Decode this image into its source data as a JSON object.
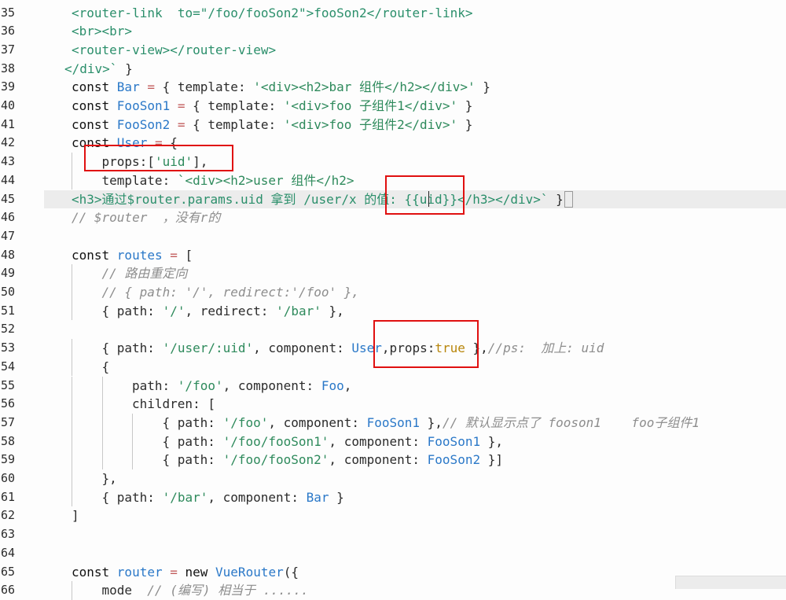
{
  "editor": {
    "lines": [
      {
        "num": "35",
        "indent": 1,
        "tokens": [
          {
            "t": "tag",
            "v": "<router-link  "
          },
          {
            "t": "tag",
            "v": "to=\"/foo/fooSon2\">fooSon2</router-link>"
          }
        ]
      },
      {
        "num": "36",
        "indent": 1,
        "tokens": [
          {
            "t": "tag",
            "v": "<br><br>"
          }
        ]
      },
      {
        "num": "37",
        "indent": 1,
        "tokens": [
          {
            "t": "tag",
            "v": "<router-view></router-view>"
          }
        ]
      },
      {
        "num": "38",
        "indent": 0,
        "lead": "  ",
        "tokens": [
          {
            "t": "tag",
            "v": "</div>`"
          },
          {
            "t": "plain",
            "v": " }"
          }
        ]
      },
      {
        "num": "39",
        "indent": 1,
        "tokens": [
          {
            "t": "kw",
            "v": "const "
          },
          {
            "t": "def",
            "v": "Bar"
          },
          {
            "t": "op",
            "v": " = "
          },
          {
            "t": "plain",
            "v": "{ template: "
          },
          {
            "t": "str",
            "v": "'<div><h2>bar 组件</h2></div>'"
          },
          {
            "t": "plain",
            "v": " }"
          }
        ]
      },
      {
        "num": "40",
        "indent": 1,
        "tokens": [
          {
            "t": "kw",
            "v": "const "
          },
          {
            "t": "def",
            "v": "FooSon1"
          },
          {
            "t": "op",
            "v": " = "
          },
          {
            "t": "plain",
            "v": "{ template: "
          },
          {
            "t": "str",
            "v": "'<div>foo 子组件1</div>'"
          },
          {
            "t": "plain",
            "v": " }"
          }
        ]
      },
      {
        "num": "41",
        "indent": 1,
        "tokens": [
          {
            "t": "kw",
            "v": "const "
          },
          {
            "t": "def",
            "v": "FooSon2"
          },
          {
            "t": "op",
            "v": " = "
          },
          {
            "t": "plain",
            "v": "{ template: "
          },
          {
            "t": "str",
            "v": "'<div>foo 子组件2</div>'"
          },
          {
            "t": "plain",
            "v": " }"
          }
        ]
      },
      {
        "num": "42",
        "indent": 1,
        "tokens": [
          {
            "t": "kw",
            "v": "const "
          },
          {
            "t": "def",
            "v": "User"
          },
          {
            "t": "op",
            "v": " = "
          },
          {
            "t": "plain",
            "v": "{"
          }
        ]
      },
      {
        "num": "43",
        "indent": 2,
        "tokens": [
          {
            "t": "plain",
            "v": "props:["
          },
          {
            "t": "str",
            "v": "'uid'"
          },
          {
            "t": "plain",
            "v": "],"
          }
        ]
      },
      {
        "num": "44",
        "indent": 2,
        "tokens": [
          {
            "t": "plain",
            "v": "template: "
          },
          {
            "t": "str",
            "v": "`<div><h2>user 组件</h2>"
          }
        ]
      },
      {
        "num": "45",
        "indent": 1,
        "current": true,
        "tokens": [
          {
            "t": "tag",
            "v": "<h3>通过$router.params.uid 拿到 /user/x 的值: {{uid}}</h3></div>`"
          },
          {
            "t": "plain",
            "v": " }"
          }
        ]
      },
      {
        "num": "46",
        "indent": 1,
        "tokens": [
          {
            "t": "cmt",
            "v": "// $router  ，没有r的"
          }
        ]
      },
      {
        "num": "47",
        "indent": 0,
        "tokens": []
      },
      {
        "num": "48",
        "indent": 1,
        "tokens": [
          {
            "t": "kw",
            "v": "const "
          },
          {
            "t": "def",
            "v": "routes"
          },
          {
            "t": "op",
            "v": " = "
          },
          {
            "t": "plain",
            "v": "["
          }
        ]
      },
      {
        "num": "49",
        "indent": 2,
        "tokens": [
          {
            "t": "cmt",
            "v": "// 路由重定向"
          }
        ]
      },
      {
        "num": "50",
        "indent": 2,
        "tokens": [
          {
            "t": "cmt",
            "v": "// { path: '/', redirect:'/foo' },"
          }
        ]
      },
      {
        "num": "51",
        "indent": 2,
        "tokens": [
          {
            "t": "plain",
            "v": "{ path: "
          },
          {
            "t": "str",
            "v": "'/'"
          },
          {
            "t": "plain",
            "v": ", redirect: "
          },
          {
            "t": "str",
            "v": "'/bar'"
          },
          {
            "t": "plain",
            "v": " },"
          }
        ]
      },
      {
        "num": "52",
        "indent": 0,
        "tokens": []
      },
      {
        "num": "53",
        "indent": 2,
        "tokens": [
          {
            "t": "plain",
            "v": "{ path: "
          },
          {
            "t": "str",
            "v": "'/user/:uid'"
          },
          {
            "t": "plain",
            "v": ", component: "
          },
          {
            "t": "def",
            "v": "User"
          },
          {
            "t": "plain",
            "v": ",props:"
          },
          {
            "t": "bool",
            "v": "true"
          },
          {
            "t": "plain",
            "v": " },"
          },
          {
            "t": "cmt",
            "v": "//ps:  加上: uid"
          }
        ]
      },
      {
        "num": "54",
        "indent": 2,
        "tokens": [
          {
            "t": "plain",
            "v": "{"
          }
        ]
      },
      {
        "num": "55",
        "indent": 3,
        "tokens": [
          {
            "t": "plain",
            "v": "path: "
          },
          {
            "t": "str",
            "v": "'/foo'"
          },
          {
            "t": "plain",
            "v": ", component: "
          },
          {
            "t": "def",
            "v": "Foo"
          },
          {
            "t": "plain",
            "v": ","
          }
        ]
      },
      {
        "num": "56",
        "indent": 3,
        "tokens": [
          {
            "t": "plain",
            "v": "children: ["
          }
        ]
      },
      {
        "num": "57",
        "indent": 4,
        "tokens": [
          {
            "t": "plain",
            "v": "{ path: "
          },
          {
            "t": "str",
            "v": "'/foo'"
          },
          {
            "t": "plain",
            "v": ", component: "
          },
          {
            "t": "def",
            "v": "FooSon1"
          },
          {
            "t": "plain",
            "v": " },"
          },
          {
            "t": "cmt",
            "v": "// 默认显示点了 fooson1    foo子组件1"
          }
        ]
      },
      {
        "num": "58",
        "indent": 4,
        "tokens": [
          {
            "t": "plain",
            "v": "{ path: "
          },
          {
            "t": "str",
            "v": "'/foo/fooSon1'"
          },
          {
            "t": "plain",
            "v": ", component: "
          },
          {
            "t": "def",
            "v": "FooSon1"
          },
          {
            "t": "plain",
            "v": " },"
          }
        ]
      },
      {
        "num": "59",
        "indent": 4,
        "tokens": [
          {
            "t": "plain",
            "v": "{ path: "
          },
          {
            "t": "str",
            "v": "'/foo/fooSon2'"
          },
          {
            "t": "plain",
            "v": ", component: "
          },
          {
            "t": "def",
            "v": "FooSon2"
          },
          {
            "t": "plain",
            "v": " }]"
          }
        ]
      },
      {
        "num": "60",
        "indent": 2,
        "tokens": [
          {
            "t": "plain",
            "v": "},"
          }
        ]
      },
      {
        "num": "61",
        "indent": 2,
        "tokens": [
          {
            "t": "plain",
            "v": "{ path: "
          },
          {
            "t": "str",
            "v": "'/bar'"
          },
          {
            "t": "plain",
            "v": ", component: "
          },
          {
            "t": "def",
            "v": "Bar"
          },
          {
            "t": "plain",
            "v": " }"
          }
        ]
      },
      {
        "num": "62",
        "indent": 1,
        "tokens": [
          {
            "t": "plain",
            "v": "]"
          }
        ]
      },
      {
        "num": "63",
        "indent": 0,
        "tokens": []
      },
      {
        "num": "64",
        "indent": 0,
        "tokens": []
      },
      {
        "num": "65",
        "indent": 1,
        "tokens": [
          {
            "t": "kw",
            "v": "const "
          },
          {
            "t": "def",
            "v": "router"
          },
          {
            "t": "op",
            "v": " = "
          },
          {
            "t": "kw",
            "v": "new "
          },
          {
            "t": "def",
            "v": "VueRouter"
          },
          {
            "t": "plain",
            "v": "({"
          }
        ]
      },
      {
        "num": "66",
        "indent": 2,
        "tokens": [
          {
            "t": "plain",
            "v": "mode"
          },
          {
            "t": "cmt",
            "v": "  // (编写) 相当于 ......"
          }
        ]
      }
    ]
  },
  "colors": {
    "highlight_box": "#e01010",
    "current_line": "#ececec",
    "tag": "#2b8f6b",
    "definition": "#2a78c8",
    "string": "#2e8a5c",
    "comment": "#8d8d8d",
    "boolean": "#b8860b"
  }
}
